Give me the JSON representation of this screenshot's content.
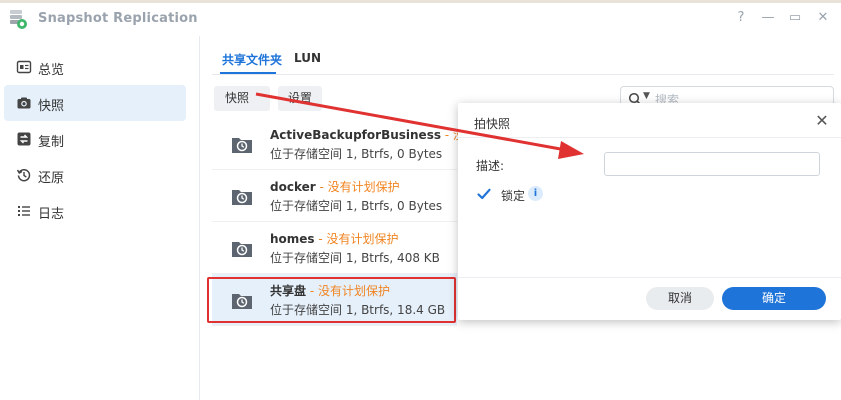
{
  "window": {
    "title": "Snapshot Replication",
    "help_glyph": "?",
    "minimize_glyph": "—",
    "maximize_glyph": "▭",
    "close_glyph": "✕"
  },
  "sidebar": {
    "items": [
      {
        "label": "总览",
        "icon": "overview-icon"
      },
      {
        "label": "快照",
        "icon": "camera-icon"
      },
      {
        "label": "复制",
        "icon": "replicate-icon"
      },
      {
        "label": "还原",
        "icon": "restore-icon"
      },
      {
        "label": "日志",
        "icon": "log-icon"
      }
    ],
    "active_index": 1
  },
  "tabs": [
    {
      "label": "共享文件夹"
    },
    {
      "label": "LUN"
    }
  ],
  "toolbar": {
    "snapshot_label": "快照",
    "settings_label": "设置",
    "search_placeholder": "搜索"
  },
  "shares": [
    {
      "name": "ActiveBackupforBusiness",
      "status": " - 没",
      "detail": "位于存储空间 1, Btrfs, 0 Bytes"
    },
    {
      "name": "docker",
      "status": " - 没有计划保护",
      "detail": "位于存储空间 1, Btrfs, 0 Bytes"
    },
    {
      "name": "homes",
      "status": " - 没有计划保护",
      "detail": "位于存储空间 1, Btrfs, 408 KB"
    },
    {
      "name": "共享盘",
      "status": " - 没有计划保护",
      "detail": "位于存储空间 1, Btrfs, 18.4 GB"
    }
  ],
  "dialog": {
    "title": "拍快照",
    "description_label": "描述:",
    "description_value": "",
    "lock_label": "锁定",
    "lock_checked": true,
    "info_glyph": "i",
    "cancel_label": "取消",
    "ok_label": "确定"
  },
  "colors": {
    "accent": "#1e74d8",
    "status_warning": "#f08421",
    "annotation": "#e13232"
  }
}
